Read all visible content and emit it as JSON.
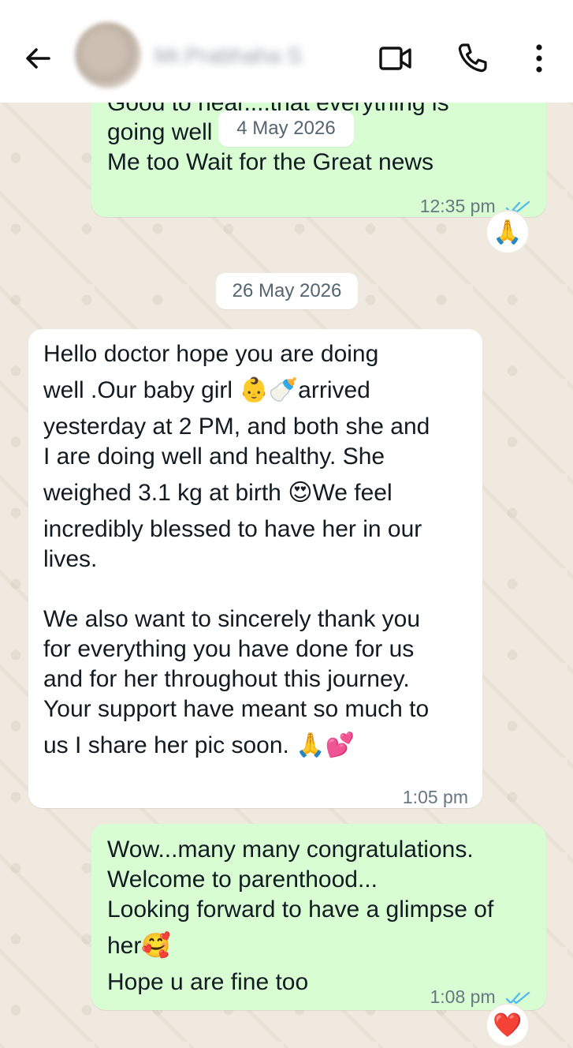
{
  "header": {
    "contact_name": "Mr.Prabhaha S",
    "icons": {
      "back": "arrow-left-icon",
      "video": "video-call-icon",
      "call": "phone-icon",
      "more": "more-vertical-icon"
    }
  },
  "messages": {
    "m1": {
      "partial_line": "Good to hear....that everything is",
      "text": "going well\nMe too Wait for the Great news",
      "time": "12:35 pm",
      "reaction": "🙏",
      "status": "read"
    },
    "date1": "4 May 2026",
    "date2": "26 May 2026",
    "m2": {
      "p1_l1": "Hello doctor hope you are doing",
      "p1_l2a": "well .Our baby girl ",
      "p1_l2_emoji": "👶🍼",
      "p1_l2b": "arrived",
      "p1_l3": "yesterday at 2 PM, and both she and",
      "p1_l4": "I are doing well and healthy. She",
      "p1_l5a": "weighed 3.1 kg at birth ",
      "p1_l5_emoji": "😍",
      "p1_l5b": "We feel",
      "p1_l6": "incredibly blessed to have her in our",
      "p1_l7": "lives.",
      "p2_l1": "We also want to sincerely thank you",
      "p2_l2": "for everything you have done for us",
      "p2_l3": "and for her throughout this journey.",
      "p2_l4": "Your support have meant so much to",
      "p2_l5": "us I share her pic soon. ",
      "p2_l5_emoji": "🙏💕",
      "time": "1:05 pm"
    },
    "m3": {
      "l1": "Wow...many many congratulations.",
      "l2": "Welcome to parenthood...",
      "l3": "Looking forward to have a glimpse of",
      "l4": "her",
      "l4_emoji": "🥰",
      "l5": "Hope u are fine too",
      "time": "1:08 pm",
      "reaction": "❤️",
      "status": "read"
    }
  },
  "colors": {
    "outgoing_bubble": "#d9fdd3",
    "incoming_bubble": "#ffffff",
    "read_ticks": "#53bdeb",
    "chat_background": "#efeae2"
  }
}
